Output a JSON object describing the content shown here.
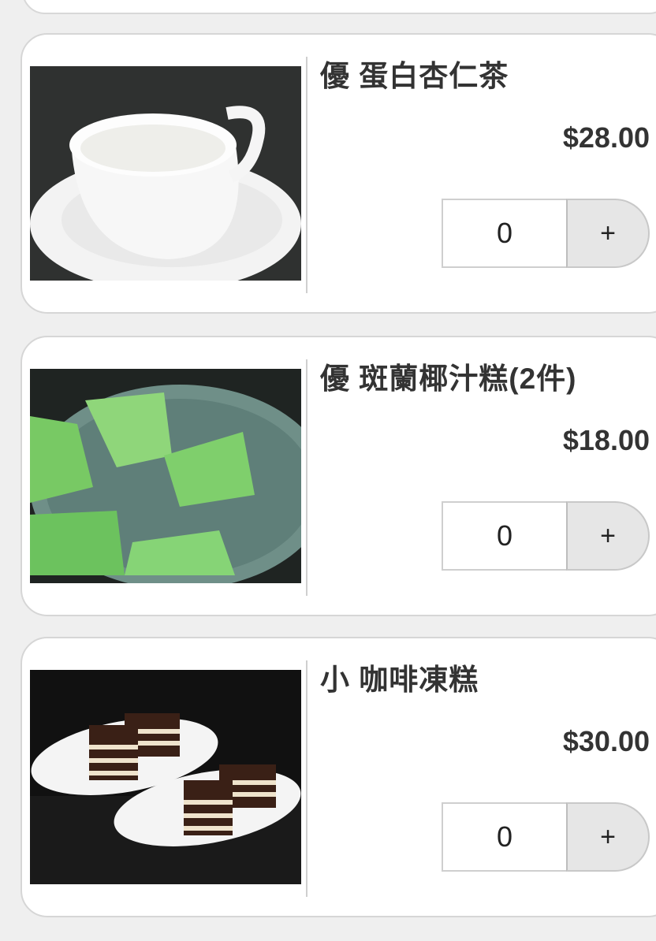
{
  "items": [
    {
      "name": "優 蛋白杏仁茶",
      "price": "$28.00",
      "quantity": "0",
      "add_label": "+"
    },
    {
      "name": "優 斑蘭椰汁糕(2件)",
      "price": "$18.00",
      "quantity": "0",
      "add_label": "+"
    },
    {
      "name": "小 咖啡凍糕",
      "price": "$30.00",
      "quantity": "0",
      "add_label": "+"
    }
  ]
}
